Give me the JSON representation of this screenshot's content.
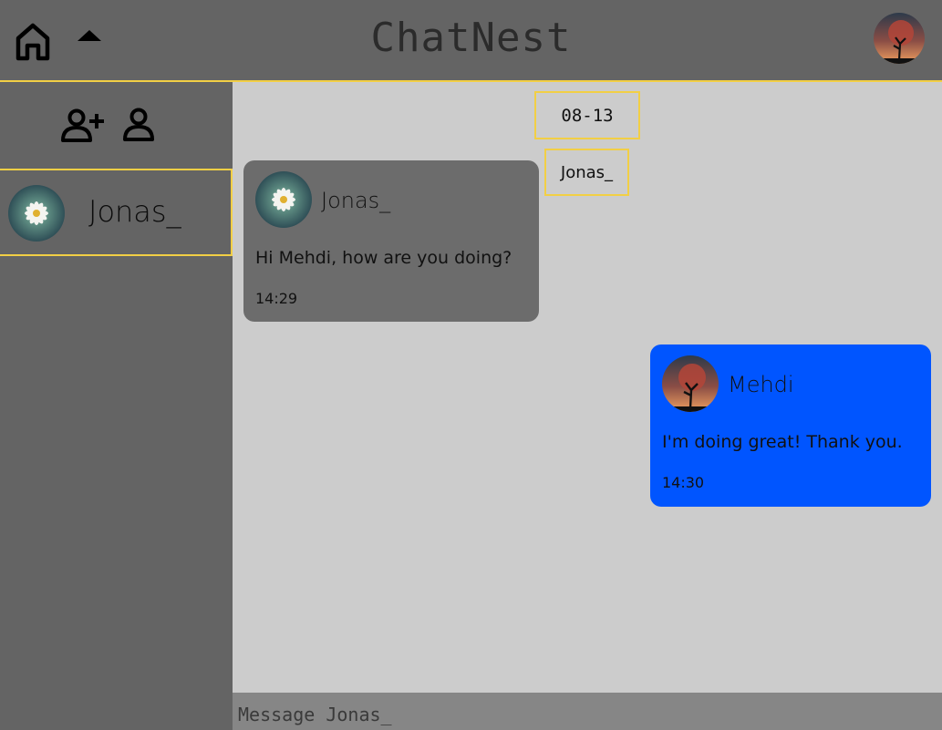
{
  "header": {
    "title": "ChatNest",
    "icons": {
      "home": "home-icon",
      "collapse": "caret-up-icon",
      "avatar": "user-avatar"
    }
  },
  "sidebar": {
    "actions": [
      {
        "icon": "add-user-icon"
      },
      {
        "icon": "profile-icon"
      }
    ],
    "contacts": [
      {
        "name": "Jonas_"
      }
    ]
  },
  "chat": {
    "date": "08-13",
    "contact_label": "Jonas_",
    "messages": [
      {
        "sender": "Jonas_",
        "text": "Hi Mehdi, how are you doing?",
        "time": "14:29",
        "direction": "incoming"
      },
      {
        "sender": "Mehdi",
        "text": "I'm doing great! Thank you.",
        "time": "14:30",
        "direction": "outgoing"
      }
    ]
  },
  "composer": {
    "placeholder": "Message Jonas_"
  },
  "colors": {
    "panel": "#646464",
    "chat_bg": "#cccccc",
    "accent_border": "#f2cf45",
    "outgoing_bubble": "#0055ff",
    "incoming_bubble": "#6c6c6c",
    "composer_bg": "#868686"
  }
}
